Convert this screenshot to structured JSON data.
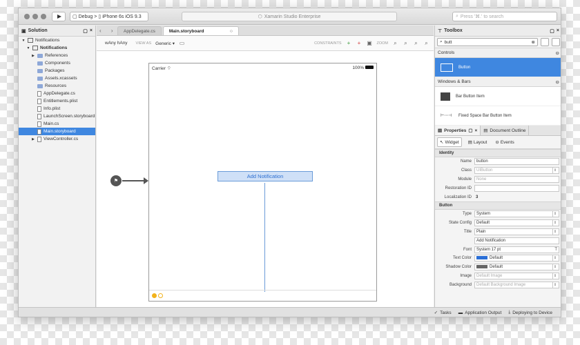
{
  "titlebar": {
    "config": "Debug",
    "separator": ">",
    "device": "iPhone 6s iOS 9.3",
    "status": "Xamarin Studio Enterprise",
    "search_placeholder": "Press '⌘.' to search"
  },
  "solution": {
    "title": "Solution",
    "items": [
      {
        "label": "Notifications",
        "level": 0,
        "expander": "▼",
        "icon": "solution-icon",
        "selected": false
      },
      {
        "label": "Notifications",
        "level": 1,
        "expander": "▼",
        "icon": "project-icon",
        "selected": false
      },
      {
        "label": "References",
        "level": 2,
        "expander": "▶",
        "icon": "folder-icon",
        "selected": false
      },
      {
        "label": "Components",
        "level": 2,
        "expander": "",
        "icon": "folder-icon",
        "selected": false
      },
      {
        "label": "Packages",
        "level": 2,
        "expander": "",
        "icon": "folder-icon",
        "selected": false
      },
      {
        "label": "Assets.xcassets",
        "level": 2,
        "expander": "",
        "icon": "folder-icon",
        "selected": false
      },
      {
        "label": "Resources",
        "level": 2,
        "expander": "",
        "icon": "folder-icon",
        "selected": false
      },
      {
        "label": "AppDelegate.cs",
        "level": 2,
        "expander": "",
        "icon": "file-icon",
        "selected": false
      },
      {
        "label": "Entitlements.plist",
        "level": 2,
        "expander": "",
        "icon": "file-icon",
        "selected": false
      },
      {
        "label": "Info.plist",
        "level": 2,
        "expander": "",
        "icon": "file-icon",
        "selected": false
      },
      {
        "label": "LaunchScreen.storyboard",
        "level": 2,
        "expander": "",
        "icon": "file-icon",
        "selected": false
      },
      {
        "label": "Main.cs",
        "level": 2,
        "expander": "",
        "icon": "file-icon",
        "selected": false
      },
      {
        "label": "Main.storyboard",
        "level": 2,
        "expander": "",
        "icon": "file-icon",
        "selected": true
      },
      {
        "label": "ViewController.cs",
        "level": 2,
        "expander": "▶",
        "icon": "file-icon",
        "selected": false
      }
    ]
  },
  "editor": {
    "tabs": [
      {
        "label": "AppDelegate.cs",
        "active": false
      },
      {
        "label": "Main.storyboard",
        "active": true
      }
    ],
    "tab_close": "○",
    "size_class": "wAny hAny",
    "view_as_label": "VIEW AS",
    "view_as_value": "Generic",
    "constraints_label": "CONSTRAINTS",
    "zoom_label": "ZOOM"
  },
  "device": {
    "carrier": "Carrier",
    "battery": "100%",
    "button_label": "Add Notification"
  },
  "toolbox": {
    "title": "Toolbox",
    "search_value": "butt",
    "sections": [
      {
        "title": "Controls",
        "items": [
          {
            "label": "Button",
            "selected": true
          }
        ]
      },
      {
        "title": "Windows & Bars",
        "items": [
          {
            "label": "Bar Button Item",
            "selected": false
          },
          {
            "label": "Fixed Space Bar Button Item",
            "selected": false
          }
        ]
      }
    ]
  },
  "properties": {
    "tab_properties": "Properties",
    "tab_outline": "Document Outline",
    "subtabs": [
      "Widget",
      "Layout",
      "Events"
    ],
    "identity_title": "Identity",
    "identity": [
      {
        "label": "Name",
        "value": "button",
        "placeholder": "",
        "kind": "text"
      },
      {
        "label": "Class",
        "value": "",
        "placeholder": "UIButton",
        "kind": "combo"
      },
      {
        "label": "Module",
        "value": "",
        "placeholder": "None",
        "kind": "text"
      },
      {
        "label": "Restoration ID",
        "value": "",
        "placeholder": "",
        "kind": "text"
      },
      {
        "label": "Localization ID",
        "value": "3",
        "placeholder": "",
        "kind": "plain"
      }
    ],
    "button_title": "Button",
    "button": [
      {
        "label": "Type",
        "value": "System",
        "placeholder": "",
        "kind": "select"
      },
      {
        "label": "State Config",
        "value": "Default",
        "placeholder": "",
        "kind": "select"
      },
      {
        "label": "Title",
        "value": "Plain",
        "placeholder": "",
        "kind": "select"
      },
      {
        "label": "",
        "value": "Add Notification",
        "placeholder": "",
        "kind": "text"
      },
      {
        "label": "Font",
        "value": "System 17 pt",
        "placeholder": "",
        "kind": "font"
      },
      {
        "label": "Text Color",
        "value": "Default",
        "placeholder": "",
        "kind": "color",
        "swatch": "#2b6fd6"
      },
      {
        "label": "Shadow Color",
        "value": "Default",
        "placeholder": "",
        "kind": "color",
        "swatch": "#666666"
      },
      {
        "label": "Image",
        "value": "",
        "placeholder": "Default Image",
        "kind": "combo"
      },
      {
        "label": "Background",
        "value": "",
        "placeholder": "Default Background Image",
        "kind": "combo"
      }
    ]
  },
  "bottombar": {
    "tasks": "Tasks",
    "app_output": "Application Output",
    "deploying": "Deploying to Device"
  },
  "colors": {
    "selection": "#3f87e0",
    "button_fill": "#cfe0f7",
    "button_text": "#2d6fd1"
  }
}
